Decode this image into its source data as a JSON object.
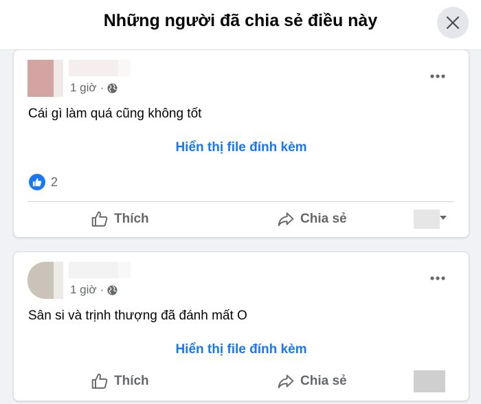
{
  "header": {
    "title": "Những người đã chia sẻ điều này"
  },
  "posts": [
    {
      "time": "1 giờ",
      "separator": "·",
      "text": "Cái gì làm quá cũng không tốt",
      "attachment_label": "Hiển thị file đính kèm",
      "reaction_count": "2",
      "like_label": "Thích",
      "share_label": "Chia sẻ"
    },
    {
      "time": "1 giờ",
      "separator": "·",
      "text": "Sân si và trịnh thượng đã đánh mất O",
      "attachment_label": "Hiển thị file đính kèm",
      "like_label": "Thích",
      "share_label": "Chia sẻ"
    }
  ],
  "colors": {
    "accent": "#1877f2",
    "secondary_text": "#65676b"
  },
  "icons": [
    "close-icon",
    "globe-icon",
    "more-icon",
    "like-reaction-icon",
    "thumbs-up-icon",
    "share-arrow-icon"
  ]
}
